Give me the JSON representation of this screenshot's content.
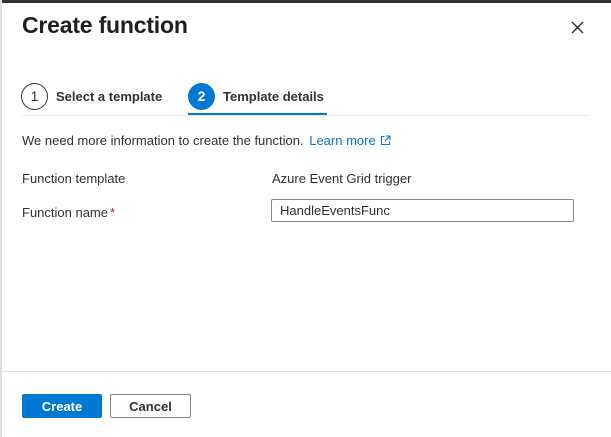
{
  "dialog": {
    "title": "Create function",
    "close_icon": "close-icon"
  },
  "steps": [
    {
      "number": "1",
      "label": "Select a template",
      "state": "completed"
    },
    {
      "number": "2",
      "label": "Template details",
      "state": "active"
    }
  ],
  "info": {
    "text": "We need more information to create the function.",
    "link_label": "Learn more",
    "link_icon": "external-link-icon"
  },
  "form": {
    "template_label": "Function template",
    "template_value": "Azure Event Grid trigger",
    "name_label": "Function name",
    "required_marker": "*",
    "name_value": "HandleEventsFunc"
  },
  "footer": {
    "create_label": "Create",
    "cancel_label": "Cancel"
  },
  "colors": {
    "accent": "#0078d4",
    "text": "#323130",
    "required": "#a4262c"
  }
}
